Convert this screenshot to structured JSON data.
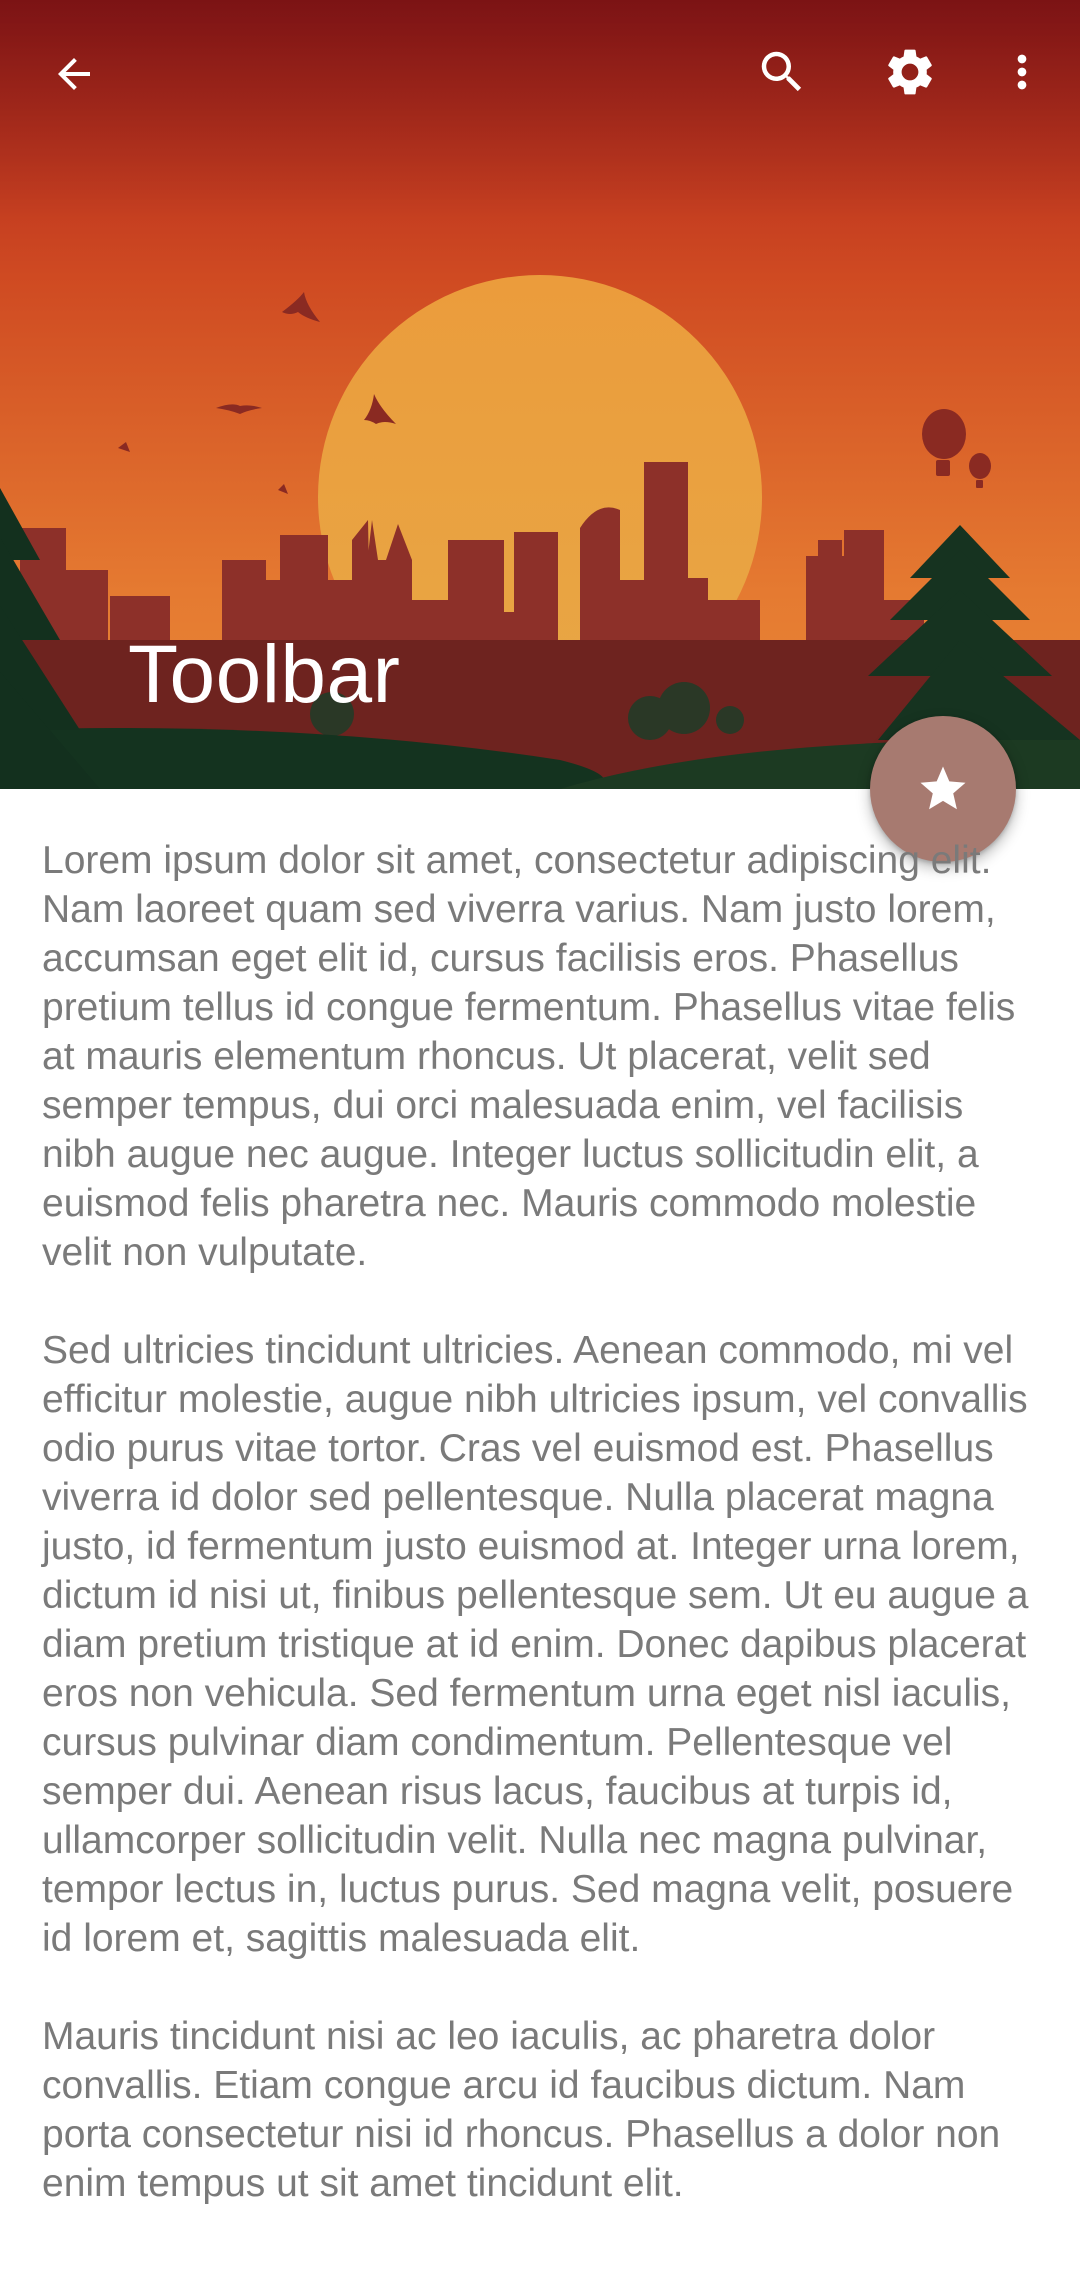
{
  "toolbar": {
    "title": "Toolbar",
    "icons": {
      "back": "arrow-left-icon",
      "search": "search-icon",
      "settings": "gear-icon",
      "more": "more-vert-icon"
    }
  },
  "fab": {
    "icon": "star-icon",
    "color": "#a77a70"
  },
  "colors": {
    "sky_top": "#a5191b",
    "sky_bottom": "#ea8a37",
    "sun": "#e9a443",
    "city": "#8b2f28",
    "hill_dark": "#12301f",
    "text": "#7a7a7a"
  },
  "content": {
    "paragraphs": [
      "Lorem ipsum dolor sit amet, consectetur adipiscing elit. Nam laoreet quam sed viverra varius. Nam justo lorem, accumsan eget elit id, cursus facilisis eros. Phasellus pretium tellus id congue fermentum. Phasellus vitae felis at mauris elementum rhoncus. Ut placerat, velit sed semper tempus, dui orci malesuada enim, vel facilisis nibh augue nec augue. Integer luctus sollicitudin elit, a euismod felis pharetra nec. Mauris commodo molestie velit non vulputate.",
      "Sed ultricies tincidunt ultricies. Aenean commodo, mi vel efficitur molestie, augue nibh ultricies ipsum, vel convallis odio purus vitae tortor. Cras vel euismod est. Phasellus viverra id dolor sed pellentesque. Nulla placerat magna justo, id fermentum justo euismod at. Integer urna lorem, dictum id nisi ut, finibus pellentesque sem. Ut eu augue a diam pretium tristique at id enim. Donec dapibus placerat eros non vehicula. Sed fermentum urna eget nisl iaculis, cursus pulvinar diam condimentum. Pellentesque vel semper dui. Aenean risus lacus, faucibus at turpis id, ullamcorper sollicitudin velit. Nulla nec magna pulvinar, tempor lectus in, luctus purus. Sed magna velit, posuere id lorem et, sagittis malesuada elit.",
      "Mauris tincidunt nisi ac leo iaculis, ac pharetra dolor convallis. Etiam congue arcu id faucibus dictum. Nam porta consectetur nisi id rhoncus. Phasellus a dolor non enim tempus ut sit amet tincidunt elit."
    ]
  }
}
